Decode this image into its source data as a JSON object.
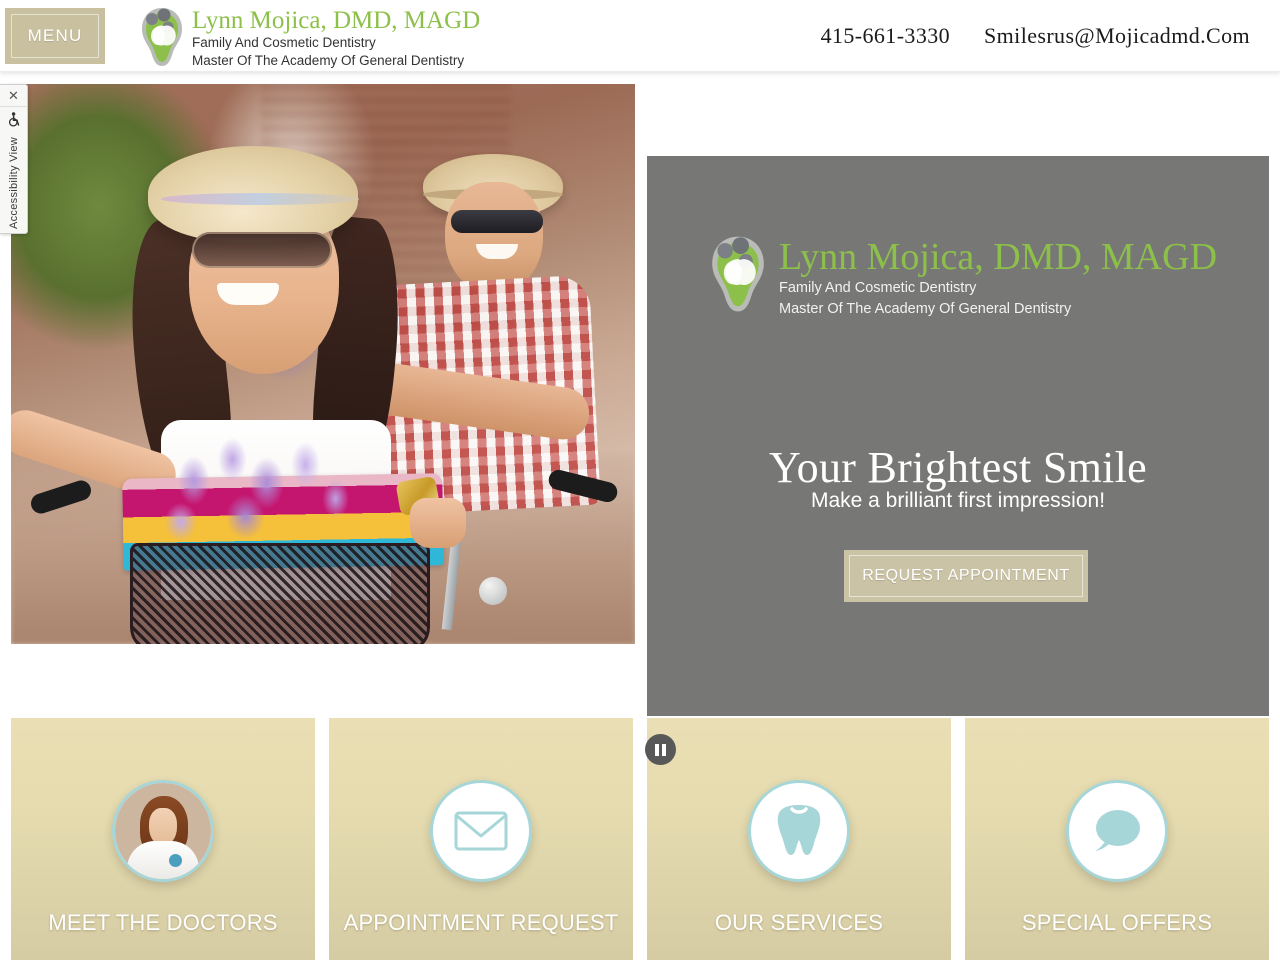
{
  "header": {
    "menu_label": "MENU",
    "logo": {
      "icon": "family-tooth-logo",
      "title": "Lynn Mojica, DMD, MAGD",
      "subtitle1": "Family And Cosmetic Dentistry",
      "subtitle2": "Master Of The Academy Of General Dentistry"
    },
    "phone": "415-661-3330",
    "email": "Smilesrus@Mojicadmd.Com"
  },
  "accessibility_widget": {
    "close_icon": "close-icon",
    "icon": "wheelchair-icon",
    "label": "Accessibility View"
  },
  "hero": {
    "photo_alt": "Smiling couple riding bicycles with flower basket",
    "panel": {
      "logo_icon": "family-tooth-logo",
      "title": "Lynn Mojica, DMD, MAGD",
      "subtitle1": "Family And Cosmetic Dentistry",
      "subtitle2": "Master Of The Academy Of General Dentistry",
      "headline": "Your Brightest Smile",
      "tagline": "Make a brilliant first impression!",
      "cta_label": "REQUEST APPOINTMENT"
    },
    "slider_control": {
      "icon": "pause-icon",
      "state": "playing"
    }
  },
  "cards": [
    {
      "label": "MEET THE DOCTORS",
      "icon": "doctor-portrait-photo"
    },
    {
      "label": "APPOINTMENT REQUEST",
      "icon": "envelope-icon"
    },
    {
      "label": "OUR SERVICES",
      "icon": "tooth-icon"
    },
    {
      "label": "SPECIAL OFFERS",
      "icon": "speech-bubble-icon"
    }
  ],
  "colors": {
    "brand_green": "#8dc04a",
    "tan_accent": "#c9c0a0",
    "card_bg": "#e6dcb0",
    "panel_gray": "#777776",
    "icon_teal": "#a7d6d8"
  }
}
